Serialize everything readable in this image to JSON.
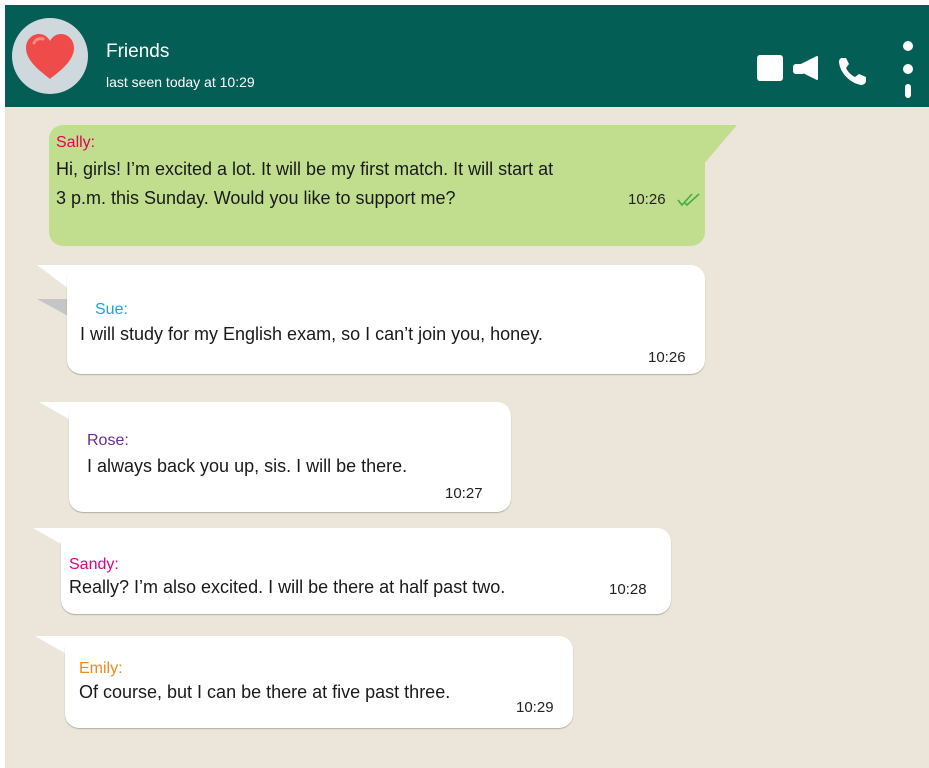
{
  "header": {
    "chat_name": "Friends",
    "status": "last seen today at 10:29",
    "bg_color": "#035e55"
  },
  "icons": {
    "avatar": "heart-icon",
    "video": "video-call-icon",
    "voice": "phone-icon",
    "menu": "more-vert-icon"
  },
  "messages": [
    {
      "sender": "Sally:",
      "sender_color": "#e3005f",
      "lines": [
        "Hi, girls! I’m excited a lot. It will be my first match. It will start at",
        "3 p.m. this Sunday. Would you like to support me?"
      ],
      "time": "10:26",
      "status": "read-ticks",
      "direction": "outgoing"
    },
    {
      "sender": "Sue:",
      "sender_color": "#1aa6d8",
      "lines": [
        "I will study for my English exam, so I can’t join you, honey."
      ],
      "time": "10:26",
      "direction": "incoming"
    },
    {
      "sender": "Rose:",
      "sender_color": "#6b2c91",
      "lines": [
        "I always back you up, sis. I will be there."
      ],
      "time": "10:27",
      "direction": "incoming"
    },
    {
      "sender": "Sandy:",
      "sender_color": "#e3007f",
      "lines": [
        "Really? I’m also excited. I will be there at half past two."
      ],
      "time": "10:28",
      "direction": "incoming"
    },
    {
      "sender": "Emily:",
      "sender_color": "#f08a1c",
      "lines": [
        "Of course, but I can be there at five past three."
      ],
      "time": "10:29",
      "direction": "incoming"
    }
  ]
}
